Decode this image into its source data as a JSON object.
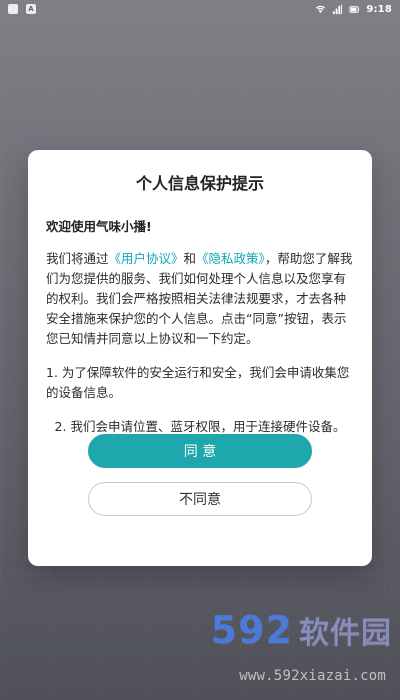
{
  "status_bar": {
    "left_icons": [
      "sim-card-icon",
      "app-a-icon"
    ],
    "time": "9:18"
  },
  "dialog": {
    "title": "个人信息保护提示",
    "welcome": "欢迎使用气味小播!",
    "para_prefix": "我们将通过",
    "user_agreement": "《用户协议》",
    "and_text": "和",
    "privacy_policy": "《隐私政策》",
    "para_suffix": "，帮助您了解我们为您提供的服务、我们如何处理个人信息以及您享有的权利。我们会严格按照相关法律法规要求，才去各种安全措施来保护您的个人信息。点击“同意”按钮，表示您已知情并同意以上协议和一下约定。",
    "point_1": "1. 为了保障软件的安全运行和安全，我们会申请收集您的设备信息。",
    "point_2": "2. 我们会申请位置、蓝牙权限，用于连接硬件设备。",
    "agree_label": "同 意",
    "disagree_label": "不同意"
  },
  "watermark": {
    "top": "592",
    "top_cn": "软件园",
    "bottom": "www.592xiazai.com"
  },
  "colors": {
    "accent": "#1ea8ad",
    "link": "#15a6b3"
  }
}
